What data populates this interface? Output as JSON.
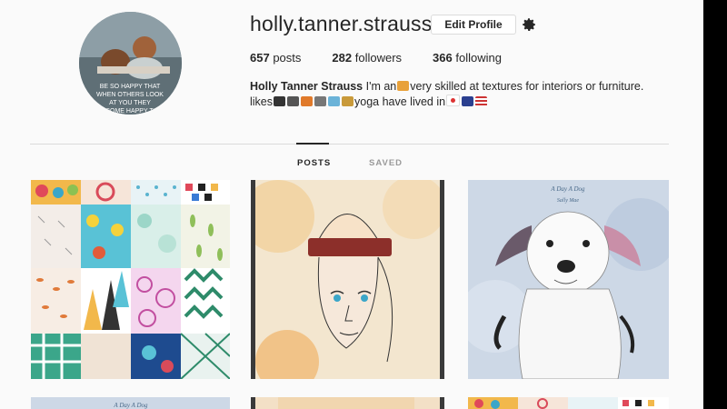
{
  "profile": {
    "username": "holly.tanner.strauss",
    "edit_profile_label": "Edit Profile",
    "avatar_caption": "BE SO HAPPY THAT WHEN OTHERS LOOK AT YOU THEY BECOME HAPPY TOO"
  },
  "stats": {
    "posts_count": "657",
    "posts_label": "posts",
    "followers_count": "282",
    "followers_label": "followers",
    "following_count": "366",
    "following_label": "following"
  },
  "bio": {
    "name": "Holly Tanner Strauss",
    "line1_part1": "I'm an",
    "line1_part2": "very skilled at textures for interiors or furniture.",
    "line2_part1": "likes",
    "line2_part2": "yoga have lived in"
  },
  "tabs": {
    "posts": "POSTS",
    "saved": "SAVED"
  },
  "posts": {
    "p3_title": "A Day A Dog",
    "p3_subtitle": "Sally Mae",
    "p4_title": "A Day A Dog"
  },
  "colors": {
    "text": "#262626",
    "muted": "#999999",
    "border": "#dbdbdb",
    "background": "#fafafa"
  },
  "icons": {
    "settings": "gear-icon"
  }
}
